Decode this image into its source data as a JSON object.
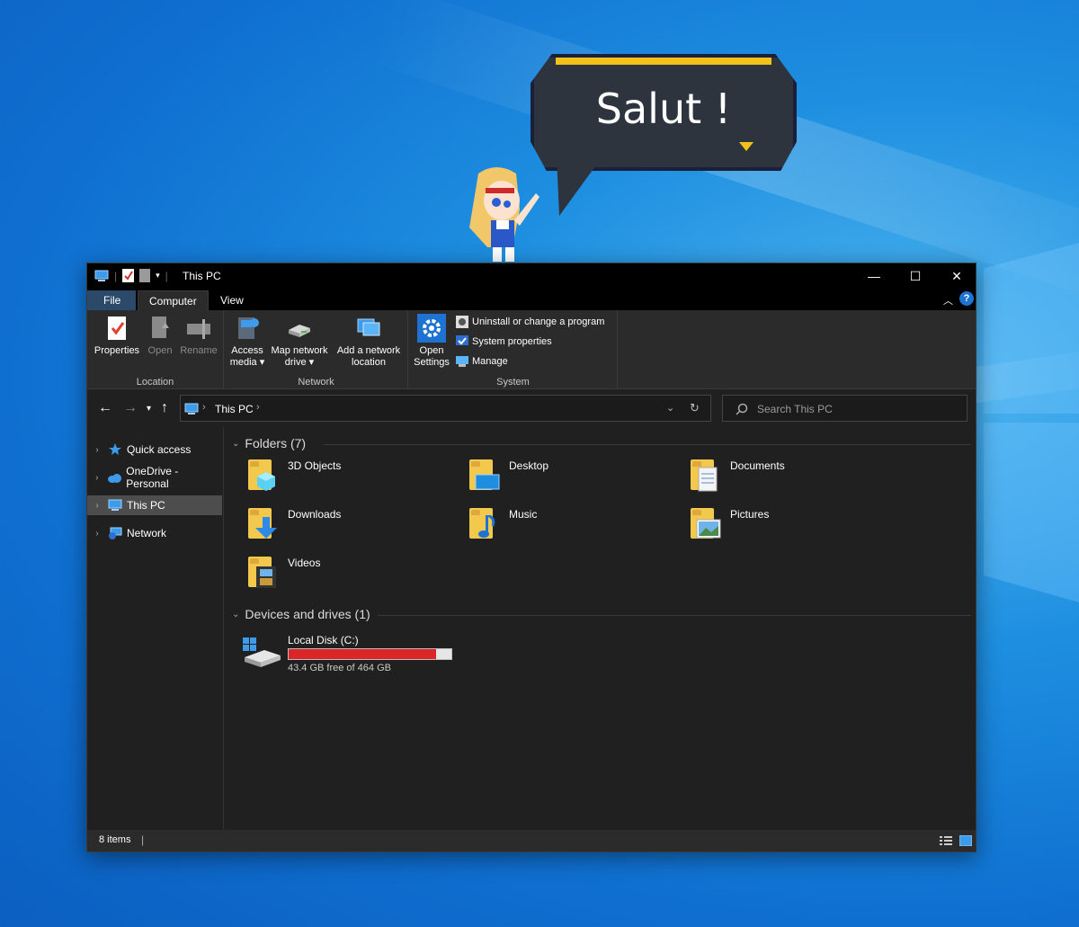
{
  "desktop": {
    "bubble_text": "Salut !"
  },
  "window": {
    "title": "This PC",
    "controls": {
      "minimize": "—",
      "maximize": "☐",
      "close": "✕"
    },
    "help": "?"
  },
  "ribbon": {
    "tabs": [
      "File",
      "Computer",
      "View"
    ],
    "groups": {
      "location": {
        "label": "Location",
        "buttons": [
          "Properties",
          "Open",
          "Rename"
        ]
      },
      "network": {
        "label": "Network",
        "access_media": [
          "Access",
          "media ▾"
        ],
        "map_drive": [
          "Map network",
          "drive ▾"
        ],
        "add_location": [
          "Add a network",
          "location"
        ]
      },
      "system": {
        "label": "System",
        "open_settings": [
          "Open",
          "Settings"
        ],
        "items": [
          "Uninstall or change a program",
          "System properties",
          "Manage"
        ]
      }
    }
  },
  "address": {
    "path": "This PC",
    "search_placeholder": "Search This PC"
  },
  "nav": {
    "items": [
      "Quick access",
      "OneDrive - Personal",
      "This PC",
      "Network"
    ]
  },
  "content": {
    "folders_header": "Folders (7)",
    "folders": [
      "3D Objects",
      "Desktop",
      "Documents",
      "Downloads",
      "Music",
      "Pictures",
      "Videos"
    ],
    "devices_header": "Devices and drives (1)",
    "drive": {
      "name": "Local Disk (C:)",
      "free_text": "43.4 GB free of 464 GB",
      "used_fraction": 0.906
    }
  },
  "status": {
    "items": "8 items"
  },
  "colors": {
    "desktop_blue": "#0f6fd0",
    "window_bg": "#202020",
    "accent": "#0078d7",
    "drive_bar": "#da2626",
    "bubble_gold": "#f3c21a"
  }
}
